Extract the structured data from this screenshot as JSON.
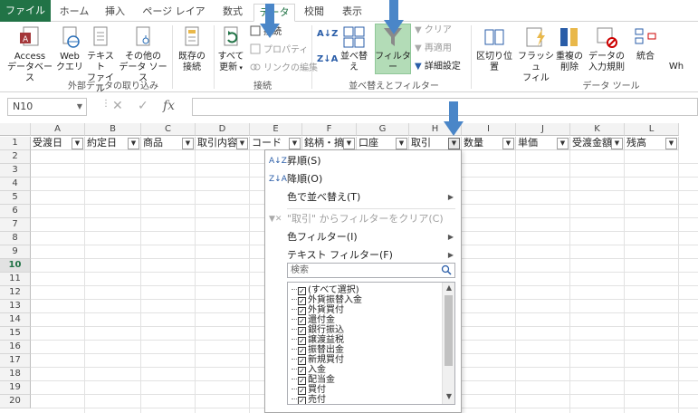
{
  "tabs": [
    "ファイル",
    "ホーム",
    "挿入",
    "ページ レイアウト",
    "数式",
    "データ",
    "校閲",
    "表示"
  ],
  "ribbon": {
    "access": "Access\nデータベース",
    "web": "Web\nクエリ",
    "text": "テキスト\nファイル",
    "other": "その他の\nデータ ソース",
    "existing": "既存の\n接続",
    "refresh": "すべて\n更新",
    "connections": "接続",
    "properties": "プロパティ",
    "editlinks": "リンクの編集",
    "sort": "並べ替え",
    "filter": "フィルター",
    "clear": "クリア",
    "reapply": "再適用",
    "advanced": "詳細設定",
    "textcols": "区切り位置",
    "flashfill": "フラッシュ\nフィル",
    "dupremove": "重複の\n削除",
    "validation": "データの\n入力規則",
    "consolidate": "統合",
    "whatif": "Wh",
    "group_external": "外部データの取り込み",
    "group_connections": "接続",
    "group_sortfilter": "並べ替えとフィルター",
    "group_datatools": "データ ツール"
  },
  "formula": {
    "namebox": "N10",
    "fx": "fx"
  },
  "columns": [
    "A",
    "B",
    "C",
    "D",
    "E",
    "F",
    "G",
    "H",
    "I",
    "J",
    "K",
    "L"
  ],
  "rows": [
    "1",
    "2",
    "3",
    "4",
    "5",
    "6",
    "7",
    "8",
    "9",
    "10",
    "11",
    "12",
    "13",
    "14",
    "15",
    "16",
    "17",
    "18",
    "19",
    "20"
  ],
  "headers": [
    "受渡日",
    "約定日",
    "商品",
    "取引内容",
    "コード",
    "銘柄・摘要",
    "口座",
    "取引",
    "数量",
    "単価",
    "受渡金額",
    "残高"
  ],
  "menu": {
    "asc": "昇順(S)",
    "desc": "降順(O)",
    "colorsort": "色で並べ替え(T)",
    "clearfilter": "\"取引\" からフィルターをクリア(C)",
    "colorfilter": "色フィルター(I)",
    "textfilter": "テキスト フィルター(F)",
    "search_placeholder": "検索",
    "items": [
      "(すべて選択)",
      "外貨振替入金",
      "外貨買付",
      "還付金",
      "銀行振込",
      "譲渡益税",
      "振替出金",
      "新規買付",
      "入金",
      "配当金",
      "買付",
      "売付"
    ]
  },
  "colors": {
    "excel_green": "#217346",
    "arrow_blue": "#4a86c8",
    "filter_active": "#b3dcb7"
  }
}
